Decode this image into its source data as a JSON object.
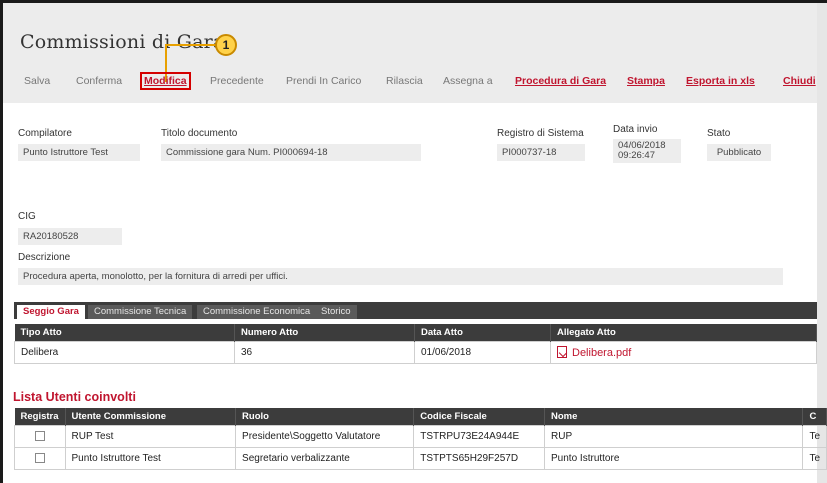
{
  "page": {
    "title": "Commissioni di Gara",
    "callout_number": "1"
  },
  "toolbar": {
    "items": [
      {
        "label": "Salva",
        "style": "disabled"
      },
      {
        "label": "Conferma",
        "style": "disabled"
      },
      {
        "label": "Modifica",
        "style": "highlighted"
      },
      {
        "label": "Precedente",
        "style": "disabled"
      },
      {
        "label": "Prendi In Carico",
        "style": "disabled"
      },
      {
        "label": "Rilascia",
        "style": "disabled"
      },
      {
        "label": "Assegna a",
        "style": "disabled"
      },
      {
        "label": "Procedura di Gara",
        "style": "link"
      },
      {
        "label": "Stampa",
        "style": "link"
      },
      {
        "label": "Esporta in xls",
        "style": "link"
      },
      {
        "label": "Chiudi",
        "style": "link"
      }
    ]
  },
  "header_fields": {
    "compilatore": {
      "label": "Compilatore",
      "value": "Punto Istruttore Test"
    },
    "titolo": {
      "label": "Titolo documento",
      "value": "Commissione gara Num. PI000694-18"
    },
    "registro": {
      "label": "Registro di Sistema",
      "value": "PI000737-18"
    },
    "data_invio": {
      "label": "Data invio",
      "value_date": "04/06/2018",
      "value_time": "09:26:47"
    },
    "stato": {
      "label": "Stato",
      "value": "Pubblicato"
    }
  },
  "details": {
    "cig": {
      "label": "CIG",
      "value": "RA20180528"
    },
    "descrizione": {
      "label": "Descrizione",
      "value": "Procedura aperta, monolotto, per la fornitura di arredi per uffici."
    }
  },
  "tabs": [
    {
      "label": "Seggio Gara",
      "active": true
    },
    {
      "label": "Commissione Tecnica",
      "active": false
    },
    {
      "label": "Commissione Economica",
      "active": false
    },
    {
      "label": "Storico",
      "active": false
    }
  ],
  "atto_table": {
    "headers": [
      "Tipo Atto",
      "Numero Atto",
      "Data Atto",
      "Allegato Atto"
    ],
    "rows": [
      {
        "tipo": "Delibera",
        "numero": "36",
        "data": "01/06/2018",
        "allegato": "Delibera.pdf"
      }
    ]
  },
  "utenti": {
    "title": "Lista Utenti coinvolti",
    "headers": [
      "Registra",
      "Utente Commissione",
      "Ruolo",
      "Codice Fiscale",
      "Nome",
      "C"
    ],
    "rows": [
      {
        "utente": "RUP Test",
        "ruolo": "Presidente\\Soggetto Valutatore",
        "cf": "TSTRPU73E24A944E",
        "nome": "RUP",
        "extra": "Te"
      },
      {
        "utente": "Punto Istruttore Test",
        "ruolo": "Segretario verbalizzante",
        "cf": "TSTPTS65H29F257D",
        "nome": "Punto Istruttore",
        "extra": "Te"
      }
    ]
  }
}
